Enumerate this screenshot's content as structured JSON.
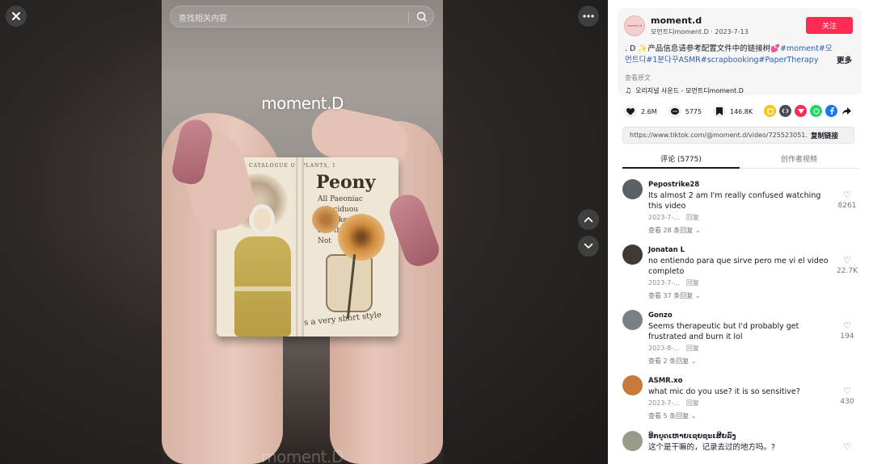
{
  "search": {
    "placeholder": "查找相关内容"
  },
  "video": {
    "watermark": "moment.D",
    "book_title": "Peony",
    "book_caption": "CATALOGUE OF PLANTS, 1",
    "book_text": "All Paeoniac\no deciduou\nd thickene\nand the\nNot",
    "book_footer": "s a very short style"
  },
  "author": {
    "avatar_text": "moment.d",
    "name": "moment.d",
    "handle": "모먼트디moment.D",
    "separator": "·",
    "date": "2023-7-13",
    "follow_label": "关注"
  },
  "description": {
    "text_prefix": ". D ✨产品信息请参考配置文件中的链接树💕",
    "hashtags": [
      "#moment",
      "#모먼트디",
      "#1분다꾸ASMR",
      "#scrapbooking",
      "#PaperTherapy"
    ],
    "more_label": "更多",
    "translate_label": "查看原文",
    "music": "오리지널 사운드 - 모먼트디moment.D"
  },
  "stats": {
    "likes": "2.6M",
    "comments": "5775",
    "saves": "146.8K"
  },
  "share": {
    "icons": [
      "embed-icon",
      "code-icon",
      "send-icon",
      "whatsapp-icon",
      "facebook-icon",
      "forward-icon"
    ],
    "colors": [
      "#f5c518",
      "#4a4b53",
      "#fe2c55",
      "#25d366",
      "#1877f2",
      "#161823"
    ]
  },
  "link": {
    "url": "https://www.tiktok.com/@moment.d/video/725523051...",
    "copy_label": "复制链接"
  },
  "tabs": {
    "comments": "评论 (5775)",
    "creator": "创作者视频"
  },
  "comments": [
    {
      "user": "Pepostrike28",
      "text": "Its almost 2 am I'm really confused watching this video",
      "date": "2023-7-...",
      "reply": "回复",
      "replies": "查看 28 条回复",
      "likes": "8261",
      "avatar_color": "#5b5f66"
    },
    {
      "user": "Jonatan L",
      "text": "no entiendo para que sirve pero me vi el video completo",
      "date": "2023-7-...",
      "reply": "回复",
      "replies": "查看 37 条回复",
      "likes": "22.7K",
      "avatar_color": "#3f3a36"
    },
    {
      "user": "Gonzo",
      "text": "Seems therapeutic but I'd probably get frustrated and burn it lol",
      "date": "2023-8-...",
      "reply": "回复",
      "replies": "查看 2 条回复",
      "likes": "194",
      "avatar_color": "#7b7f86"
    },
    {
      "user": "ASMR.xo",
      "text": "what mic do you use? it is so sensitive?",
      "date": "2023-7-...",
      "reply": "回复",
      "replies": "查看 5 条回复",
      "likes": "430",
      "avatar_color": "#c97a3a"
    },
    {
      "user": "ອີກບຸດເຫາຍເຊຍຊະເສີຍລົງ",
      "text": "这个是干嘛的，记录去过的地方吗。?",
      "date": "",
      "reply": "",
      "replies": "",
      "likes": "",
      "avatar_color": "#9a9a8a"
    }
  ],
  "colors": {
    "accent": "#fe2c55",
    "hashtag": "#2b5db9"
  }
}
